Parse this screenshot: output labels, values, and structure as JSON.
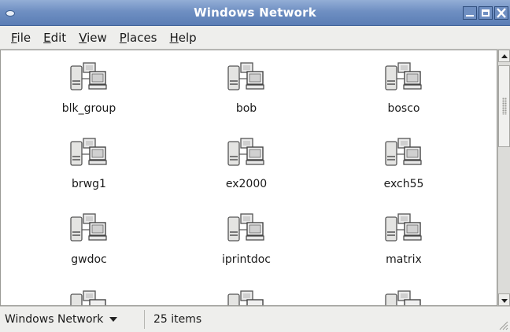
{
  "window": {
    "title": "Windows Network"
  },
  "menubar": {
    "items": [
      {
        "label": "File",
        "mnemonic": "F",
        "rest": "ile"
      },
      {
        "label": "Edit",
        "mnemonic": "E",
        "rest": "dit"
      },
      {
        "label": "View",
        "mnemonic": "V",
        "rest": "iew"
      },
      {
        "label": "Places",
        "mnemonic": "P",
        "rest": "laces"
      },
      {
        "label": "Help",
        "mnemonic": "H",
        "rest": "elp"
      }
    ]
  },
  "workgroups": [
    {
      "name": "blk_group",
      "icon": "network-workgroup-icon"
    },
    {
      "name": "bob",
      "icon": "network-workgroup-icon"
    },
    {
      "name": "bosco",
      "icon": "network-workgroup-icon"
    },
    {
      "name": "brwg1",
      "icon": "network-workgroup-icon"
    },
    {
      "name": "ex2000",
      "icon": "network-workgroup-icon"
    },
    {
      "name": "exch55",
      "icon": "network-workgroup-icon"
    },
    {
      "name": "gwdoc",
      "icon": "network-workgroup-icon"
    },
    {
      "name": "iprintdoc",
      "icon": "network-workgroup-icon"
    },
    {
      "name": "matrix",
      "icon": "network-workgroup-icon"
    }
  ],
  "statusbar": {
    "location": "Windows Network",
    "item_count": "25 items"
  },
  "colors": {
    "titlebar": "#6f8fc2",
    "chrome": "#eeeeec"
  }
}
